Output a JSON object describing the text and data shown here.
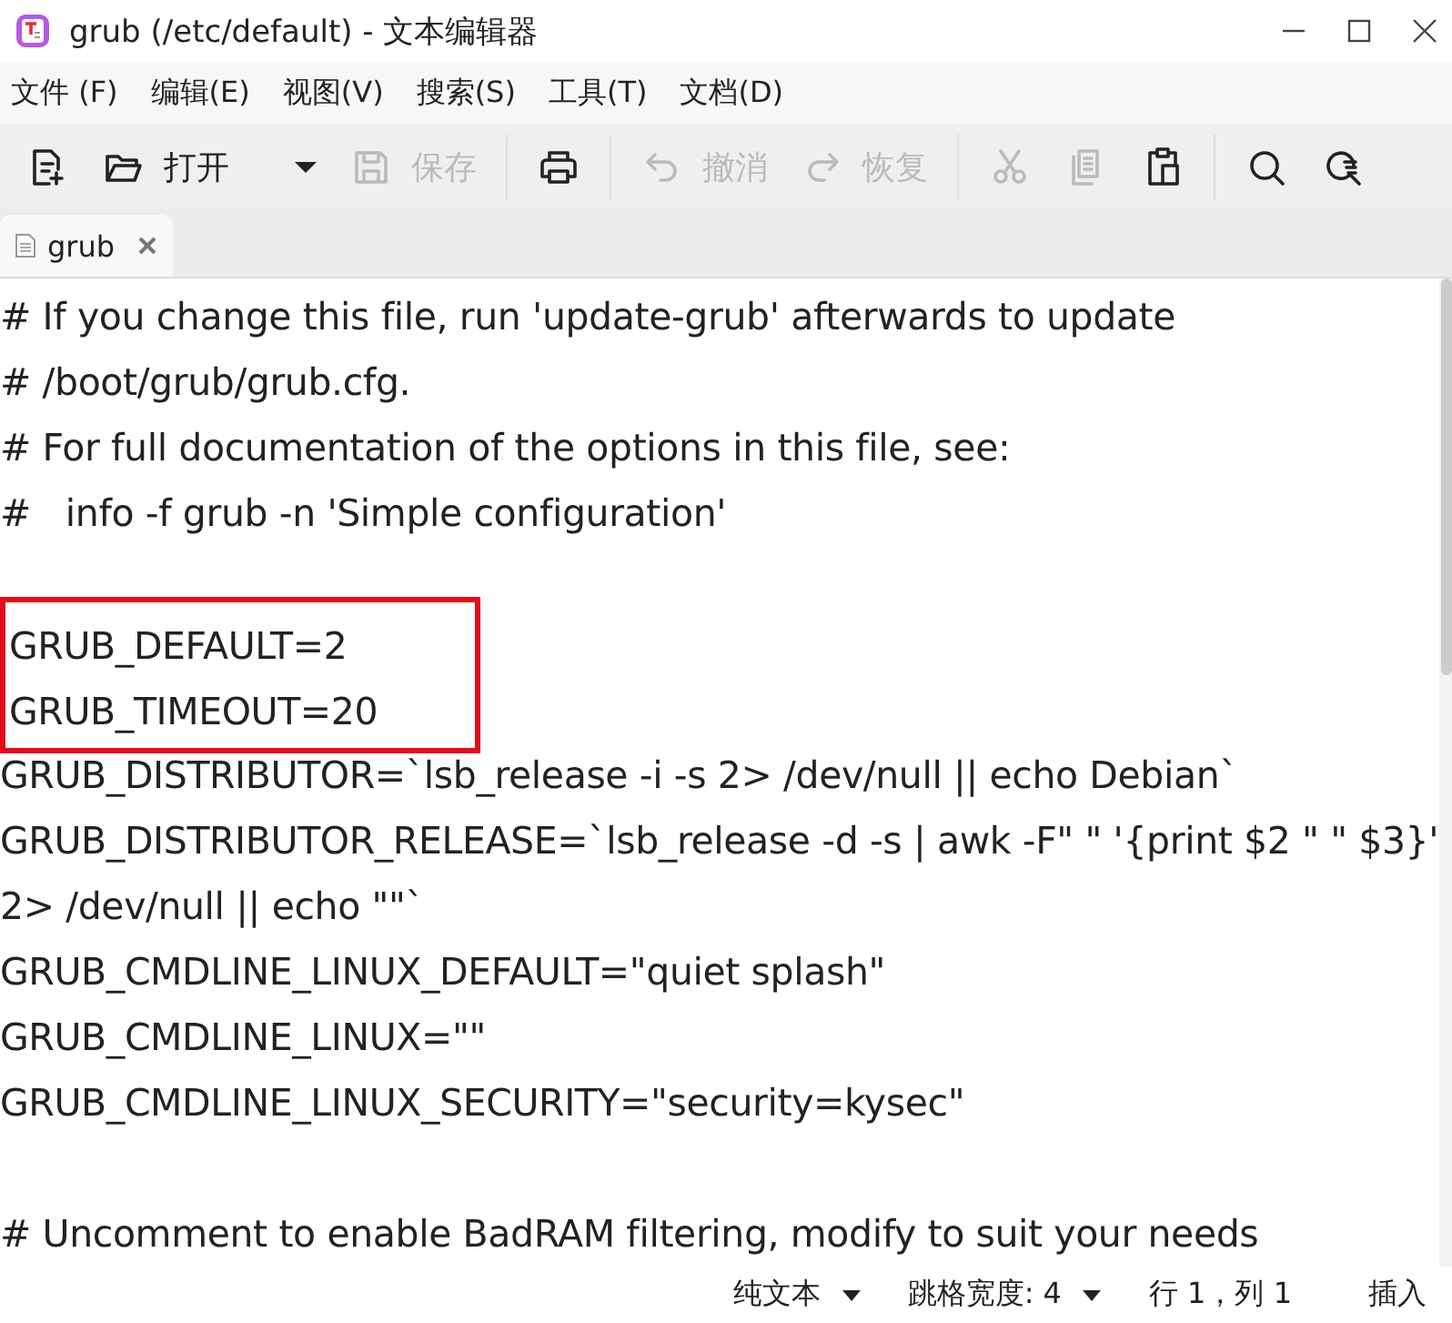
{
  "window": {
    "title": "grub (/etc/default) - 文本编辑器"
  },
  "menu": [
    "文件 (F)",
    "编辑(E)",
    "视图(V)",
    "搜索(S)",
    "工具(T)",
    "文档(D)"
  ],
  "toolbar": [
    {
      "kind": "button",
      "disabled": false
    },
    {
      "kind": "button",
      "label": "打开",
      "disabled": false
    },
    {
      "kind": "dropdown",
      "disabled": false
    },
    {
      "kind": "button",
      "label": "保存",
      "disabled": true
    },
    {
      "kind": "separator"
    },
    {
      "kind": "button",
      "disabled": false
    },
    {
      "kind": "separator"
    },
    {
      "kind": "button",
      "label": "撤消",
      "disabled": true
    },
    {
      "kind": "button",
      "label": "恢复",
      "disabled": true
    },
    {
      "kind": "separator"
    },
    {
      "kind": "button",
      "disabled": true
    },
    {
      "kind": "button",
      "disabled": true
    },
    {
      "kind": "button",
      "disabled": false
    },
    {
      "kind": "separator"
    },
    {
      "kind": "button",
      "disabled": false
    },
    {
      "kind": "button",
      "disabled": false
    }
  ],
  "tabs": [
    {
      "label": "grub",
      "selected": true
    }
  ],
  "editor": {
    "lines": [
      {
        "text": "# If you change this file, run 'update-grub' afterwards to update",
        "highlighted": false
      },
      {
        "text": "# /boot/grub/grub.cfg.",
        "highlighted": false
      },
      {
        "text": "# For full documentation of the options in this file, see:",
        "highlighted": false
      },
      {
        "text": "#   info -f grub -n 'Simple configuration'",
        "highlighted": false
      },
      {
        "text": "GRUB_DEFAULT=2",
        "highlighted": true,
        "blank_line_before": true
      },
      {
        "text": "GRUB_TIMEOUT=20",
        "highlighted": true
      },
      {
        "text": "GRUB_DISTRIBUTOR=`lsb_release -i -s 2> /dev/null || echo Debian`",
        "highlighted": false
      },
      {
        "text": "GRUB_DISTRIBUTOR_RELEASE=`lsb_release -d -s | awk -F\" \" '{print $2 \" \" $3}'",
        "highlighted": false
      },
      {
        "text": "2> /dev/null || echo \"\"`",
        "highlighted": false
      },
      {
        "text": "GRUB_CMDLINE_LINUX_DEFAULT=\"quiet splash\"",
        "highlighted": false
      },
      {
        "text": "GRUB_CMDLINE_LINUX=\"\"",
        "highlighted": false
      },
      {
        "text": "GRUB_CMDLINE_LINUX_SECURITY=\"security=kysec\"",
        "highlighted": false
      },
      {
        "text": "# Uncomment to enable BadRAM filtering, modify to suit your needs",
        "highlighted": false,
        "blank_line_before": true
      }
    ]
  },
  "status_bar": {
    "syntax": "纯文本",
    "tab_width": "跳格宽度: 4",
    "position": "行 1，列 1",
    "mode": "插入"
  }
}
